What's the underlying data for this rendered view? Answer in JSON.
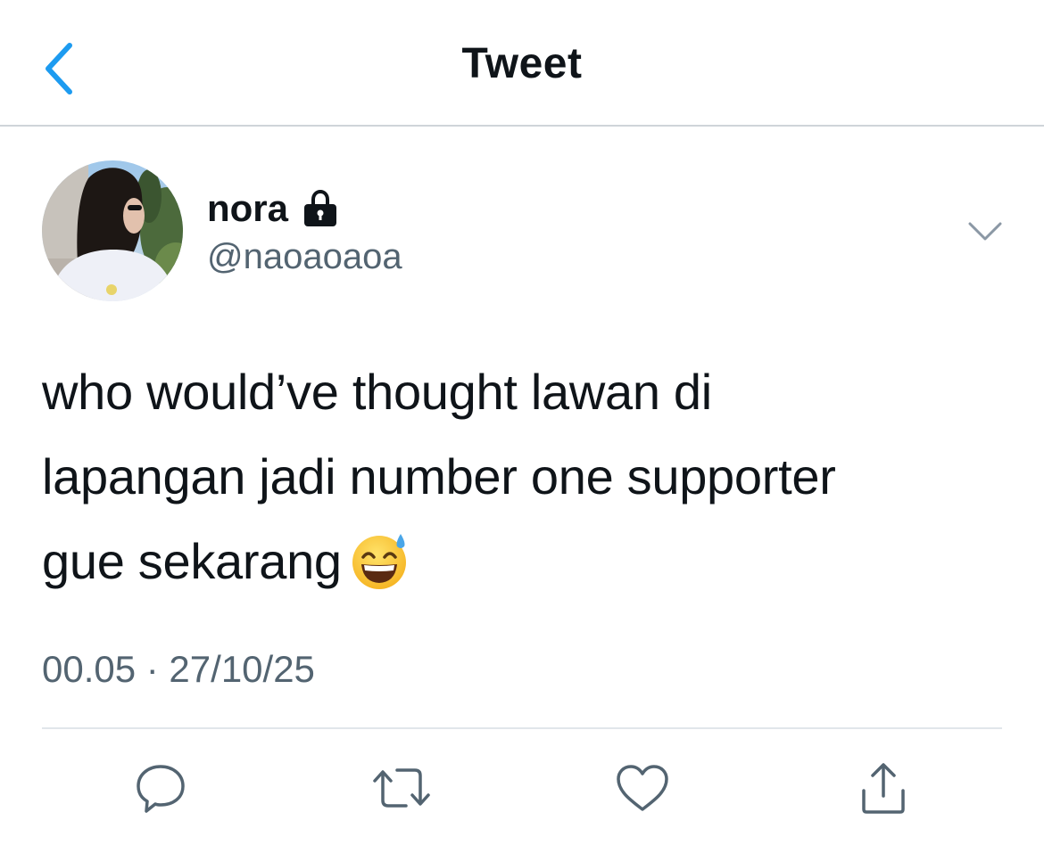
{
  "header": {
    "title": "Tweet",
    "back_icon": "chevron-left-icon"
  },
  "author": {
    "display_name": "nora",
    "handle": "@naoaoaoa",
    "protected_icon": "lock-icon",
    "avatar": "avatar-photo"
  },
  "tweet": {
    "line1": "who would’ve thought lawan di",
    "line2": "lapangan jadi number one supporter",
    "line3": "gue sekarang",
    "emoji": "grinning-face-with-sweat-emoji",
    "timestamp": "00.05 · 27/10/25"
  },
  "actions": {
    "reply_icon": "reply-icon",
    "retweet_icon": "retweet-icon",
    "like_icon": "heart-icon",
    "share_icon": "share-icon"
  },
  "colors": {
    "accent": "#1d9bf0",
    "text": "#0f1419",
    "secondary": "#536471",
    "divider": "#e1e6ea"
  }
}
